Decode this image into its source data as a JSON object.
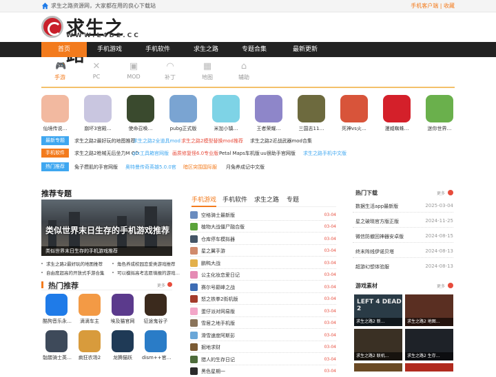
{
  "topbar": {
    "tagline": "求生之路资源网，大家都在用的良心下载站",
    "links": "手机客户端 | 收藏"
  },
  "logo": {
    "title": "求生之路",
    "domain": "WWW.L4D2.CC"
  },
  "nav": [
    "首页",
    "手机游戏",
    "手机软件",
    "求生之路",
    "专题合集",
    "最新更新"
  ],
  "categories": [
    {
      "label": "手游",
      "icon": "gamepad-icon",
      "glyph": "🎮"
    },
    {
      "label": "PC",
      "icon": "pc-icon",
      "glyph": "✕"
    },
    {
      "label": "MOD",
      "icon": "mod-icon",
      "glyph": "▣"
    },
    {
      "label": "补丁",
      "icon": "patch-icon",
      "glyph": "◠"
    },
    {
      "label": "地图",
      "icon": "map-icon",
      "glyph": "▦"
    },
    {
      "label": "辅助",
      "icon": "helper-icon",
      "glyph": "⌂"
    }
  ],
  "apps": [
    {
      "name": "仙境传说…",
      "color": "#f2b9a0"
    },
    {
      "name": "崩坏3宫殿…",
      "color": "#c9c6e0"
    },
    {
      "name": "使命召唤…",
      "color": "#3a4a2e"
    },
    {
      "name": "pubg正式版",
      "color": "#7aa4d2"
    },
    {
      "name": "米加小镇…",
      "color": "#7ed3e6"
    },
    {
      "name": "王者荣耀…",
      "color": "#8e86c9"
    },
    {
      "name": "三国志11…",
      "color": "#6d6a3e"
    },
    {
      "name": "死神vs火…",
      "color": "#d8543a"
    },
    {
      "name": "漫威蜘蛛…",
      "color": "#d4202a"
    },
    {
      "name": "迷你世界…",
      "color": "#6ab04c"
    }
  ],
  "tagrows": [
    {
      "label": "最新专题",
      "color": "#3fa7f0",
      "items": [
        "求生之路2最好玩的地图推荐",
        "求生之路2全道具mod",
        "求生之路2模型替换mod推荐",
        "求生之路2近战武器mod合集"
      ],
      "itemColors": [
        "#333",
        "#3fa7f0",
        "#e74c3c",
        "#333"
      ]
    },
    {
      "label": "手机软件",
      "color": "#f37b1d",
      "items": [
        "求生之路2枪械无后坐力M OD",
        "gfx工具箱官网版",
        "画质修复怪6.0专业版",
        "Petal Maps车机版",
        "uu很助手官网版",
        "求生之路手机中文版"
      ],
      "itemColors": [
        "#333",
        "#3fa7f0",
        "#e74c3c",
        "#333",
        "#333",
        "#3fa7f0"
      ]
    },
    {
      "label": "热门推荐",
      "color": "#3fa7f0",
      "items": [
        "兔子攒肌的手官网版",
        "奥特曼传奇英雄5.0.0官",
        "暗区突围国际服",
        "月兔养成记中文版"
      ],
      "itemColors": [
        "#333",
        "#3fa7f0",
        "#f37b1d",
        "#333"
      ]
    }
  ],
  "recommend": {
    "title": "推荐专题",
    "feature_title": "类似世界末日生存的手机游戏推荐",
    "feature_caption": "类似世界末日生存的手机游戏推荐",
    "links": [
      "求生之路2最好玩的地图推荐",
      "角色养成校园恋爱类游戏推荐",
      "自由度超高的开放式手游合集",
      "可以模拟高考志愿填报的游戏…"
    ]
  },
  "hot": {
    "title": "热门推荐",
    "more": "更多",
    "apps": [
      {
        "name": "酷狗音乐永…",
        "color": "#1f7be8"
      },
      {
        "name": "滴滴车主",
        "color": "#f39a45"
      },
      {
        "name": "埃及猫官网",
        "color": "#5b3a8c"
      },
      {
        "name": "征途鬼谷子",
        "color": "#3b2a1d"
      },
      {
        "name": "骷髅骑士英…",
        "color": "#3e4a5a"
      },
      {
        "name": "疯狂农场2",
        "color": "#d89b3c"
      },
      {
        "name": "龙腾猫跃",
        "color": "#1f3a56"
      },
      {
        "name": "dism++官…",
        "color": "#2a7cc7"
      }
    ]
  },
  "tabs": [
    "手机游戏",
    "手机软件",
    "求生之路",
    "专题"
  ],
  "games": [
    {
      "name": "空格骑士最新版",
      "date": "03-04",
      "color": "#6a8cbf"
    },
    {
      "name": "植物大战僵尸融合版",
      "date": "03-04",
      "color": "#5aa33a"
    },
    {
      "name": "仓库停车模拟器",
      "date": "03-04",
      "color": "#445566"
    },
    {
      "name": "星之翼手游",
      "date": "03-04",
      "color": "#d08a6c"
    },
    {
      "name": "鹏鸭大战",
      "date": "03-04",
      "color": "#e3b04b"
    },
    {
      "name": "公主化妆恋爱日记",
      "date": "03-04",
      "color": "#e58bb4"
    },
    {
      "name": "赛尔号巅峰之战",
      "date": "03-04",
      "color": "#3d6cb4"
    },
    {
      "name": "怒之铁拳2街机版",
      "date": "03-04",
      "color": "#a33b2b"
    },
    {
      "name": "蛋仔派对网易版",
      "date": "03-04",
      "color": "#f3a6c8"
    },
    {
      "name": "雪居之地手机版",
      "date": "03-04",
      "color": "#8a7359"
    },
    {
      "name": "滑雪速度阿斯彭",
      "date": "03-04",
      "color": "#6aa7d8"
    },
    {
      "name": "掘地求财",
      "date": "03-04",
      "color": "#7a5a33"
    },
    {
      "name": "猎人的生存日记",
      "date": "03-04",
      "color": "#4d6b3a"
    },
    {
      "name": "黑色星期一",
      "date": "03-04",
      "color": "#2a2a2a"
    }
  ],
  "downloads": {
    "title": "热门下载",
    "more": "更多",
    "rows": [
      {
        "name": "数据生活app最新版",
        "date": "2025-03-04"
      },
      {
        "name": "星之破晓官方版正版",
        "date": "2024-11-25"
      },
      {
        "name": "微信防撤回神器安卓版",
        "date": "2024-08-15"
      },
      {
        "name": "终末阵线伊诺贝塔",
        "date": "2024-08-13"
      },
      {
        "name": "超游幻想体验服",
        "date": "2024-08-13"
      }
    ]
  },
  "materials": {
    "title": "游戏素材",
    "more": "更多",
    "tiles": [
      {
        "caption": "求生之路2 新…",
        "big": "LEFT 4 DEAD 2",
        "color": "#2a3b46"
      },
      {
        "caption": "求生之路2 地图…",
        "big": "",
        "color": "#5a2f22"
      },
      {
        "caption": "求生之路2 联机…",
        "big": "",
        "color": "#3a3024"
      },
      {
        "caption": "求生之路2 生存…",
        "big": "",
        "color": "#1e2228"
      },
      {
        "caption": "",
        "big": "",
        "color": "#6a4a24"
      },
      {
        "caption": "",
        "big": "",
        "color": "#b02a1e"
      }
    ]
  }
}
